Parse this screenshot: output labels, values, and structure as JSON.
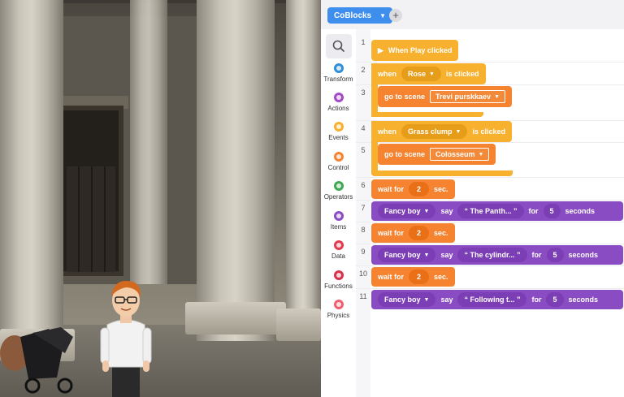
{
  "header": {
    "tab_label": "CoBlocks",
    "add_tab_label": "+"
  },
  "categories": [
    {
      "label": "Transform",
      "color": "#2f8fd8"
    },
    {
      "label": "Actions",
      "color": "#a54ac6"
    },
    {
      "label": "Events",
      "color": "#f7b12e"
    },
    {
      "label": "Control",
      "color": "#f5832f"
    },
    {
      "label": "Operators",
      "color": "#3ea853"
    },
    {
      "label": "Items",
      "color": "#8a4cc3"
    },
    {
      "label": "Data",
      "color": "#e53950"
    },
    {
      "label": "Functions",
      "color": "#d8304a"
    },
    {
      "label": "Physics",
      "color": "#f25e6f"
    }
  ],
  "line_numbers": [
    "1",
    "2",
    "3",
    "4",
    "5",
    "6",
    "7",
    "8",
    "9",
    "10",
    "11"
  ],
  "blocks": {
    "when_play": "When Play clicked",
    "when1": {
      "when": "when",
      "target": "Rose",
      "event": "is clicked",
      "go_to_scene": "go to scene",
      "scene": "Trevi purskkaev"
    },
    "when2": {
      "when": "when",
      "target": "Grass clump",
      "event": "is clicked",
      "go_to_scene": "go to scene",
      "scene": "Colosseum"
    },
    "wait_label": "wait for",
    "wait_unit": "sec.",
    "wait_value": "2",
    "say": [
      {
        "actor": "Fancy boy",
        "verb": "say",
        "text": "“ The Panth... ”",
        "for": "for",
        "seconds": "5",
        "unit": "seconds"
      },
      {
        "actor": "Fancy boy",
        "verb": "say",
        "text": "“ The cylindr... ”",
        "for": "for",
        "seconds": "5",
        "unit": "seconds"
      },
      {
        "actor": "Fancy boy",
        "verb": "say",
        "text": "“ Following t... ”",
        "for": "for",
        "seconds": "5",
        "unit": "seconds"
      }
    ]
  }
}
